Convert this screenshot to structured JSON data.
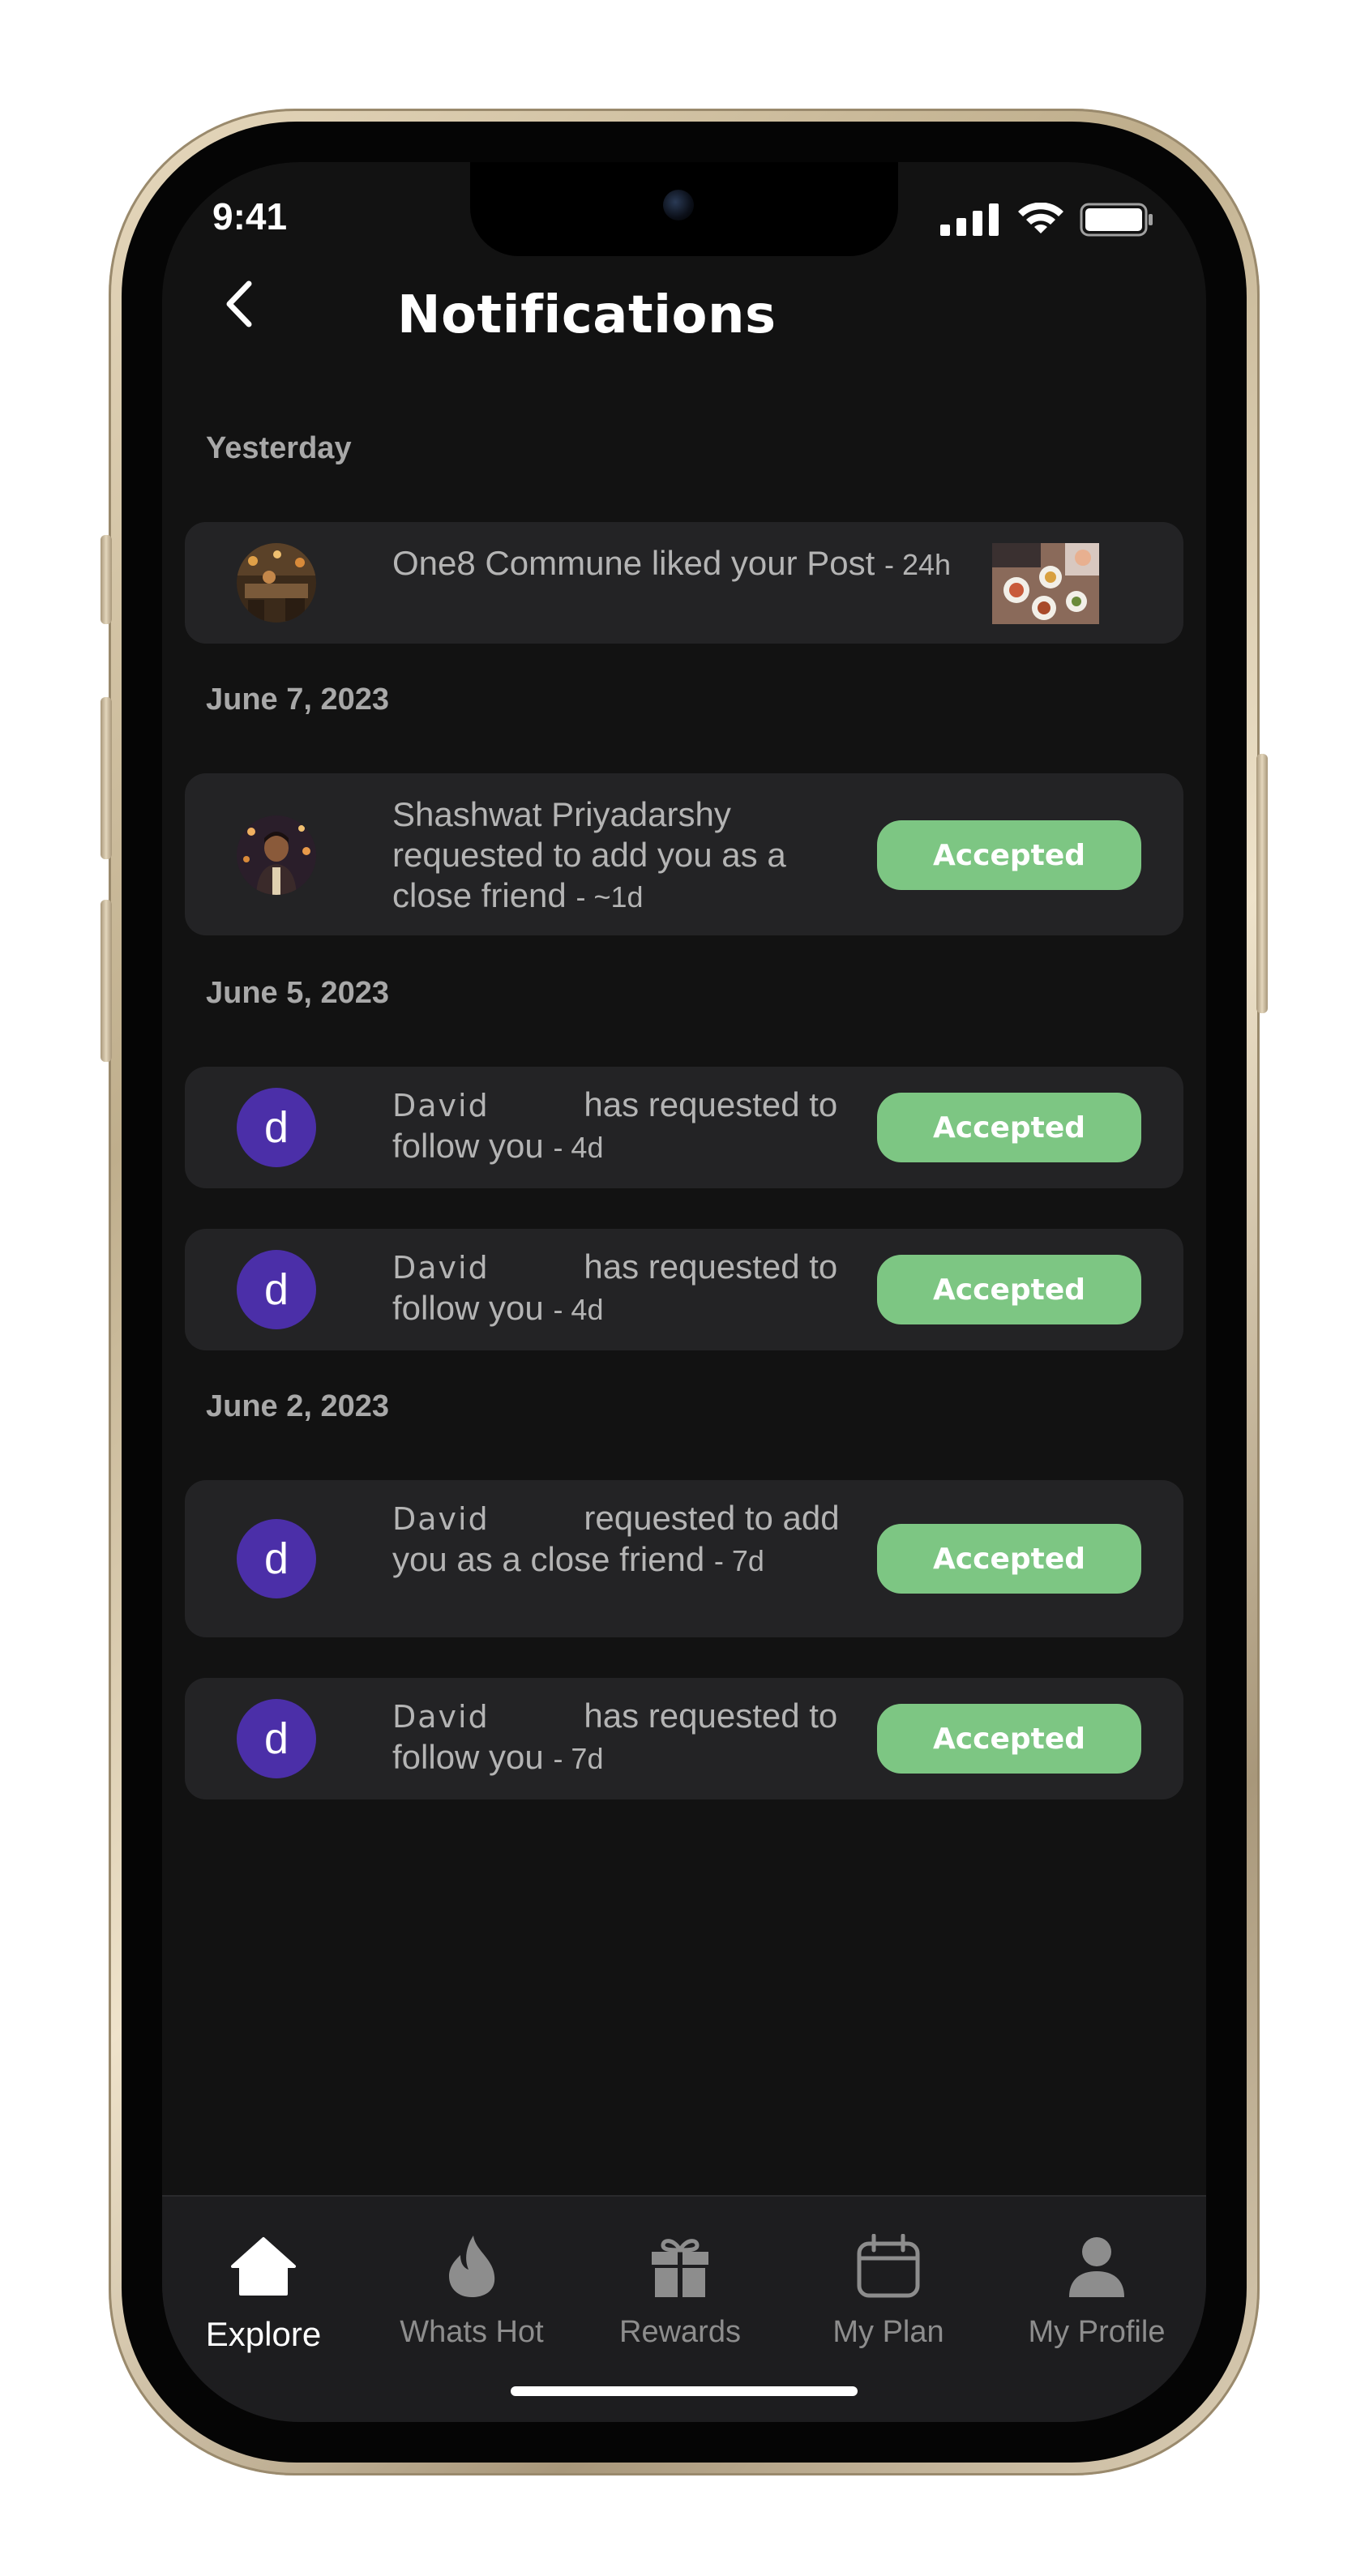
{
  "status_bar": {
    "time": "9:41"
  },
  "header": {
    "title": "Notifications"
  },
  "sections": [
    {
      "label": "Yesterday",
      "items": [
        {
          "name": "One8 Commune",
          "text": " liked your Post",
          "time": "- 24h",
          "avatar": "restaurant-photo",
          "trailing": "post-thumbnail"
        }
      ]
    },
    {
      "label": "June 7, 2023",
      "items": [
        {
          "name": "Shashwat Priyadarshy",
          "text": "requested to add you as a close friend",
          "time": "- ~1d",
          "avatar": "person-photo",
          "button": "Accepted"
        }
      ]
    },
    {
      "label": "June 5, 2023",
      "items": [
        {
          "name": "David",
          "text": "has requested to follow you",
          "time": "- 4d",
          "avatar_letter": "d",
          "button": "Accepted"
        },
        {
          "name": "David",
          "text": "has requested to follow you",
          "time": "- 4d",
          "avatar_letter": "d",
          "button": "Accepted"
        }
      ]
    },
    {
      "label": "June 2, 2023",
      "items": [
        {
          "name": "David",
          "text": "requested to add you as a close friend",
          "time": "- 7d",
          "avatar_letter": "d",
          "button": "Accepted"
        },
        {
          "name": "David",
          "text": "has requested to follow you",
          "time": "- 7d",
          "avatar_letter": "d",
          "button": "Accepted"
        }
      ]
    }
  ],
  "tabbar": {
    "active": "Explore",
    "tabs": [
      {
        "label": "Explore",
        "icon": "home-icon"
      },
      {
        "label": "Whats Hot",
        "icon": "flame-icon"
      },
      {
        "label": "Rewards",
        "icon": "gift-icon"
      },
      {
        "label": "My Plan",
        "icon": "calendar-icon"
      },
      {
        "label": "My Profile",
        "icon": "person-icon"
      }
    ]
  },
  "colors": {
    "screen_bg": "#121212",
    "card_bg": "#232325",
    "accepted_green": "#7dc683",
    "avatar_purple": "#4b2fa8"
  }
}
